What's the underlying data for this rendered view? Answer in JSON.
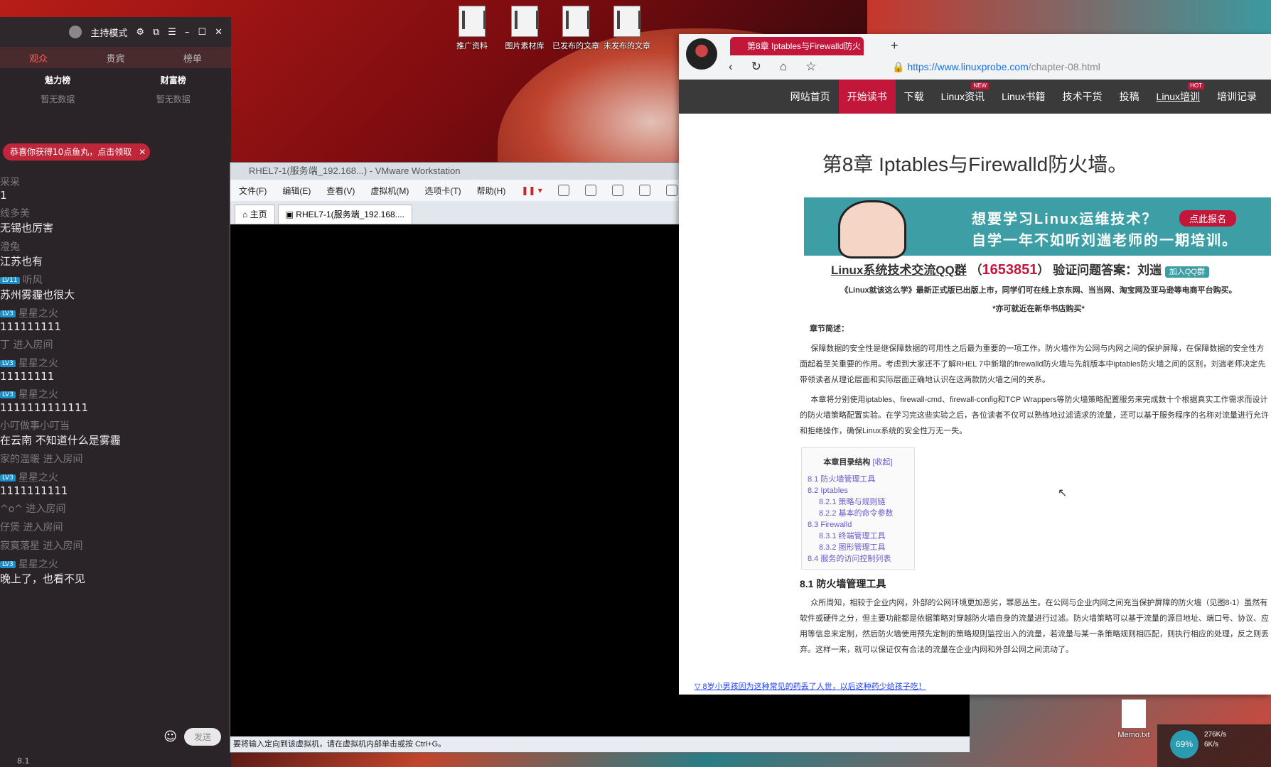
{
  "desktop": {
    "icons": [
      "推广资料",
      "图片素材库",
      "已发布的文章",
      "未发布的文章"
    ],
    "memo_file": "Memo.txt"
  },
  "stream": {
    "mode_label": "主持模式",
    "tabs": [
      "观众",
      "贵宾",
      "榜单"
    ],
    "ranks": [
      {
        "label": "魅力榜",
        "empty": "暂无数据"
      },
      {
        "label": "财富榜",
        "empty": "暂无数据"
      }
    ],
    "notice": "恭喜你获得10点鱼丸，点击领取",
    "notice_close": "✕",
    "messages": [
      {
        "user": "采采",
        "level": "",
        "text": "1"
      },
      {
        "user": "线多美",
        "level": "",
        "text": "无锡也厉害"
      },
      {
        "user": "澄兔",
        "level": "",
        "text": "江苏也有"
      },
      {
        "user": "听风",
        "level": "LV11",
        "text": "苏州雾霾也很大"
      },
      {
        "user": "星星之火",
        "level": "LV3",
        "text": "111111111"
      },
      {
        "user": "丁 进入房间",
        "level": "",
        "text": ""
      },
      {
        "user": "星星之火",
        "level": "LV3",
        "text": "11111111"
      },
      {
        "user": "星星之火",
        "level": "LV3",
        "text": "1111111111111"
      },
      {
        "user": "小叮做事小叮当",
        "level": "",
        "text": "在云南 不知道什么是雾霾"
      },
      {
        "user": "家的温暖 进入房间",
        "level": "",
        "text": ""
      },
      {
        "user": "星星之火",
        "level": "LV3",
        "text": "1111111111"
      },
      {
        "user": "^o^ 进入房间",
        "level": "",
        "text": ""
      },
      {
        "user": "仔煲 进入房间",
        "level": "",
        "text": ""
      },
      {
        "user": "寂寞落星 进入房间",
        "level": "",
        "text": ""
      },
      {
        "user": "星星之火",
        "level": "LV3",
        "text": "晚上了，也看不见"
      }
    ],
    "send": "发送",
    "version": "8.1"
  },
  "vmware": {
    "title": "RHEL7-1(服务端_192.168...) - VMware Workstation",
    "menu": [
      "文件(F)",
      "编辑(E)",
      "查看(V)",
      "虚拟机(M)",
      "选项卡(T)",
      "帮助(H)"
    ],
    "tabs": [
      "主页",
      "RHEL7-1(服务端_192.168...."
    ],
    "status": "要将输入定向到该虚拟机，请在虚拟机内部单击或按 Ctrl+G。"
  },
  "browser": {
    "tab_title": "第8章 Iptables与Firewalld防火",
    "url_prefix": "https://www.linuxprobe.com",
    "url_path": "/chapter-08.html",
    "nav": [
      {
        "label": "网站首页",
        "active": false,
        "badge": ""
      },
      {
        "label": "开始读书",
        "active": true,
        "badge": ""
      },
      {
        "label": "下载",
        "active": false,
        "badge": ""
      },
      {
        "label": "Linux资讯",
        "active": false,
        "badge": "NEW"
      },
      {
        "label": "Linux书籍",
        "active": false,
        "badge": ""
      },
      {
        "label": "技术干货",
        "active": false,
        "badge": ""
      },
      {
        "label": "投稿",
        "active": false,
        "badge": ""
      },
      {
        "label": "Linux培训",
        "active": false,
        "badge": "HOT"
      },
      {
        "label": "培训记录",
        "active": false,
        "badge": ""
      }
    ],
    "heading": "第8章 Iptables与Firewalld防火墙。",
    "banner_line1": "想要学习Linux运维技术？",
    "banner_line2": "自学一年不如听刘遄老师的一期培训。",
    "banner_button": "点此报名",
    "qq_prefix": "Linux系统技术交流QQ群",
    "qq_number": "1653851",
    "qq_suffix": "验证问题答案：刘遄",
    "qq_join": "加入QQ群",
    "promo": "《Linux就该这么学》最新正式版已出版上市，同学们可在线上京东网、当当网、淘宝网及亚马逊等电商平台购买。",
    "promo2": "*亦可就近在新华书店购买*",
    "summary_label": "章节简述：",
    "para1": "保障数据的安全性是继保障数据的可用性之后最为重要的一项工作。防火墙作为公网与内网之间的保护屏障，在保障数据的安全性方面起着至关重要的作用。考虑到大家还不了解RHEL 7中新增的firewalld防火墙与先前版本中iptables防火墙之间的区别，刘遄老师决定先带领读者从理论层面和实际层面正确地认识在这两款防火墙之间的关系。",
    "para2": "本章将分别使用iptables、firewall-cmd、firewall-config和TCP Wrappers等防火墙策略配置服务来完成数十个根据真实工作需求而设计的防火墙策略配置实验。在学习完这些实验之后，各位读者不仅可以熟练地过滤请求的流量，还可以基于服务程序的名称对流量进行允许和拒绝操作，确保Linux系统的安全性万无一失。",
    "toc_title": "本章目录结构",
    "toc_collapse": "[收起]",
    "toc": [
      {
        "text": "8.1 防火墙管理工具",
        "sub": false
      },
      {
        "text": "8.2 Iptables",
        "sub": false
      },
      {
        "text": "8.2.1 策略与规则链",
        "sub": true
      },
      {
        "text": "8.2.2 基本的命令参数",
        "sub": true
      },
      {
        "text": "8.3 Firewalld",
        "sub": false
      },
      {
        "text": "8.3.1 终端管理工具",
        "sub": true
      },
      {
        "text": "8.3.2 图形管理工具",
        "sub": true
      },
      {
        "text": "8.4 服务的访问控制列表",
        "sub": false
      }
    ],
    "section_title": "8.1 防火墙管理工具",
    "section_para": "众所周知，相较于企业内网，外部的公网环境更加恶劣，罪恶丛生。在公网与企业内网之间充当保护屏障的防火墙（见图8-1）虽然有软件或硬件之分，但主要功能都是依据策略对穿越防火墙自身的流量进行过滤。防火墙策略可以基于流量的源目地址、端口号、协议、应用等信息来定制，然后防火墙使用预先定制的策略规则监控出入的流量，若流量与某一条策略规则相匹配，则执行相应的处理，反之则丢弃。这样一来，就可以保证仅有合法的流量在企业内网和外部公网之间流动了。",
    "footer_link": "8岁小男孩因为这种常见的药丢了人世，以后这种药少给孩子吃！"
  },
  "tray": {
    "battery": "69%",
    "up": "276K/s",
    "down": "6K/s"
  }
}
